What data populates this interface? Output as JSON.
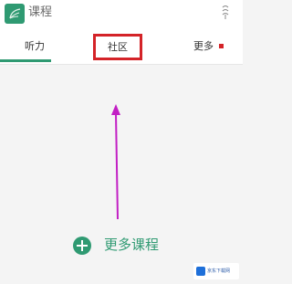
{
  "header": {
    "title": "课程",
    "icons": {
      "app": "leaf-logo-icon",
      "right": "antenna-icon"
    }
  },
  "tabs": [
    {
      "label": "听力",
      "active": true
    },
    {
      "label": "社区",
      "highlighted": true
    },
    {
      "label": "更多",
      "badge": "red-dot"
    }
  ],
  "main": {
    "more_courses_label": "更多课程",
    "annotation": "arrow-up-icon"
  },
  "watermark": {
    "text": "京东下载网",
    "icon": "site-logo-icon"
  },
  "colors": {
    "accent": "#2f9a72",
    "highlight_border": "#d42328",
    "arrow": "#c21fc4",
    "background": "#f4f4f4"
  }
}
